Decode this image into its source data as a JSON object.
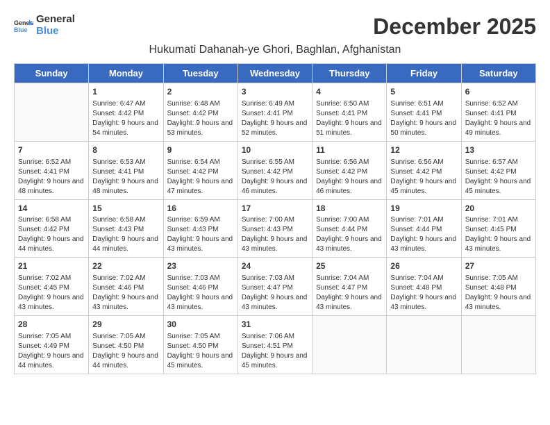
{
  "logo": {
    "line1": "General",
    "line2": "Blue"
  },
  "title": "December 2025",
  "subtitle": "Hukumati Dahanah-ye Ghori, Baghlan, Afghanistan",
  "days_of_week": [
    "Sunday",
    "Monday",
    "Tuesday",
    "Wednesday",
    "Thursday",
    "Friday",
    "Saturday"
  ],
  "weeks": [
    [
      {
        "day": "",
        "sunrise": "",
        "sunset": "",
        "daylight": ""
      },
      {
        "day": "1",
        "sunrise": "Sunrise: 6:47 AM",
        "sunset": "Sunset: 4:42 PM",
        "daylight": "Daylight: 9 hours and 54 minutes."
      },
      {
        "day": "2",
        "sunrise": "Sunrise: 6:48 AM",
        "sunset": "Sunset: 4:42 PM",
        "daylight": "Daylight: 9 hours and 53 minutes."
      },
      {
        "day": "3",
        "sunrise": "Sunrise: 6:49 AM",
        "sunset": "Sunset: 4:41 PM",
        "daylight": "Daylight: 9 hours and 52 minutes."
      },
      {
        "day": "4",
        "sunrise": "Sunrise: 6:50 AM",
        "sunset": "Sunset: 4:41 PM",
        "daylight": "Daylight: 9 hours and 51 minutes."
      },
      {
        "day": "5",
        "sunrise": "Sunrise: 6:51 AM",
        "sunset": "Sunset: 4:41 PM",
        "daylight": "Daylight: 9 hours and 50 minutes."
      },
      {
        "day": "6",
        "sunrise": "Sunrise: 6:52 AM",
        "sunset": "Sunset: 4:41 PM",
        "daylight": "Daylight: 9 hours and 49 minutes."
      }
    ],
    [
      {
        "day": "7",
        "sunrise": "Sunrise: 6:52 AM",
        "sunset": "Sunset: 4:41 PM",
        "daylight": "Daylight: 9 hours and 48 minutes."
      },
      {
        "day": "8",
        "sunrise": "Sunrise: 6:53 AM",
        "sunset": "Sunset: 4:41 PM",
        "daylight": "Daylight: 9 hours and 48 minutes."
      },
      {
        "day": "9",
        "sunrise": "Sunrise: 6:54 AM",
        "sunset": "Sunset: 4:42 PM",
        "daylight": "Daylight: 9 hours and 47 minutes."
      },
      {
        "day": "10",
        "sunrise": "Sunrise: 6:55 AM",
        "sunset": "Sunset: 4:42 PM",
        "daylight": "Daylight: 9 hours and 46 minutes."
      },
      {
        "day": "11",
        "sunrise": "Sunrise: 6:56 AM",
        "sunset": "Sunset: 4:42 PM",
        "daylight": "Daylight: 9 hours and 46 minutes."
      },
      {
        "day": "12",
        "sunrise": "Sunrise: 6:56 AM",
        "sunset": "Sunset: 4:42 PM",
        "daylight": "Daylight: 9 hours and 45 minutes."
      },
      {
        "day": "13",
        "sunrise": "Sunrise: 6:57 AM",
        "sunset": "Sunset: 4:42 PM",
        "daylight": "Daylight: 9 hours and 45 minutes."
      }
    ],
    [
      {
        "day": "14",
        "sunrise": "Sunrise: 6:58 AM",
        "sunset": "Sunset: 4:42 PM",
        "daylight": "Daylight: 9 hours and 44 minutes."
      },
      {
        "day": "15",
        "sunrise": "Sunrise: 6:58 AM",
        "sunset": "Sunset: 4:43 PM",
        "daylight": "Daylight: 9 hours and 44 minutes."
      },
      {
        "day": "16",
        "sunrise": "Sunrise: 6:59 AM",
        "sunset": "Sunset: 4:43 PM",
        "daylight": "Daylight: 9 hours and 43 minutes."
      },
      {
        "day": "17",
        "sunrise": "Sunrise: 7:00 AM",
        "sunset": "Sunset: 4:43 PM",
        "daylight": "Daylight: 9 hours and 43 minutes."
      },
      {
        "day": "18",
        "sunrise": "Sunrise: 7:00 AM",
        "sunset": "Sunset: 4:44 PM",
        "daylight": "Daylight: 9 hours and 43 minutes."
      },
      {
        "day": "19",
        "sunrise": "Sunrise: 7:01 AM",
        "sunset": "Sunset: 4:44 PM",
        "daylight": "Daylight: 9 hours and 43 minutes."
      },
      {
        "day": "20",
        "sunrise": "Sunrise: 7:01 AM",
        "sunset": "Sunset: 4:45 PM",
        "daylight": "Daylight: 9 hours and 43 minutes."
      }
    ],
    [
      {
        "day": "21",
        "sunrise": "Sunrise: 7:02 AM",
        "sunset": "Sunset: 4:45 PM",
        "daylight": "Daylight: 9 hours and 43 minutes."
      },
      {
        "day": "22",
        "sunrise": "Sunrise: 7:02 AM",
        "sunset": "Sunset: 4:46 PM",
        "daylight": "Daylight: 9 hours and 43 minutes."
      },
      {
        "day": "23",
        "sunrise": "Sunrise: 7:03 AM",
        "sunset": "Sunset: 4:46 PM",
        "daylight": "Daylight: 9 hours and 43 minutes."
      },
      {
        "day": "24",
        "sunrise": "Sunrise: 7:03 AM",
        "sunset": "Sunset: 4:47 PM",
        "daylight": "Daylight: 9 hours and 43 minutes."
      },
      {
        "day": "25",
        "sunrise": "Sunrise: 7:04 AM",
        "sunset": "Sunset: 4:47 PM",
        "daylight": "Daylight: 9 hours and 43 minutes."
      },
      {
        "day": "26",
        "sunrise": "Sunrise: 7:04 AM",
        "sunset": "Sunset: 4:48 PM",
        "daylight": "Daylight: 9 hours and 43 minutes."
      },
      {
        "day": "27",
        "sunrise": "Sunrise: 7:05 AM",
        "sunset": "Sunset: 4:48 PM",
        "daylight": "Daylight: 9 hours and 43 minutes."
      }
    ],
    [
      {
        "day": "28",
        "sunrise": "Sunrise: 7:05 AM",
        "sunset": "Sunset: 4:49 PM",
        "daylight": "Daylight: 9 hours and 44 minutes."
      },
      {
        "day": "29",
        "sunrise": "Sunrise: 7:05 AM",
        "sunset": "Sunset: 4:50 PM",
        "daylight": "Daylight: 9 hours and 44 minutes."
      },
      {
        "day": "30",
        "sunrise": "Sunrise: 7:05 AM",
        "sunset": "Sunset: 4:50 PM",
        "daylight": "Daylight: 9 hours and 45 minutes."
      },
      {
        "day": "31",
        "sunrise": "Sunrise: 7:06 AM",
        "sunset": "Sunset: 4:51 PM",
        "daylight": "Daylight: 9 hours and 45 minutes."
      },
      {
        "day": "",
        "sunrise": "",
        "sunset": "",
        "daylight": ""
      },
      {
        "day": "",
        "sunrise": "",
        "sunset": "",
        "daylight": ""
      },
      {
        "day": "",
        "sunrise": "",
        "sunset": "",
        "daylight": ""
      }
    ]
  ]
}
